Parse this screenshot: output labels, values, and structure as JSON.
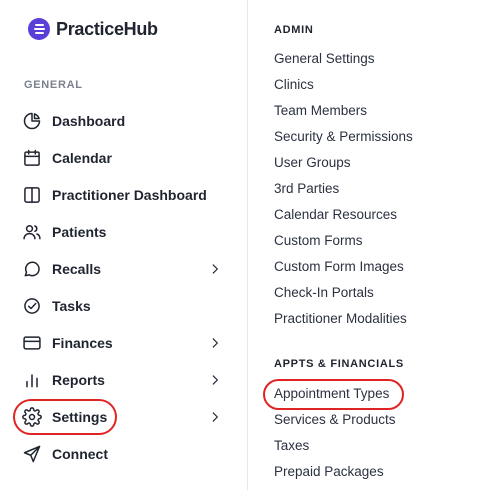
{
  "brand": {
    "name": "PracticeHub",
    "logo_color": "#5a3fd8"
  },
  "sidebar": {
    "section_label": "GENERAL",
    "items": [
      {
        "label": "Dashboard",
        "icon": "pie-chart-icon",
        "has_submenu": false
      },
      {
        "label": "Calendar",
        "icon": "calendar-icon",
        "has_submenu": false
      },
      {
        "label": "Practitioner Dashboard",
        "icon": "split-panel-icon",
        "has_submenu": false
      },
      {
        "label": "Patients",
        "icon": "users-icon",
        "has_submenu": false
      },
      {
        "label": "Recalls",
        "icon": "chat-bubble-icon",
        "has_submenu": true
      },
      {
        "label": "Tasks",
        "icon": "check-circle-icon",
        "has_submenu": false
      },
      {
        "label": "Finances",
        "icon": "credit-card-icon",
        "has_submenu": true
      },
      {
        "label": "Reports",
        "icon": "bar-chart-icon",
        "has_submenu": true
      },
      {
        "label": "Settings",
        "icon": "gear-icon",
        "has_submenu": true,
        "highlighted": true
      },
      {
        "label": "Connect",
        "icon": "send-icon",
        "has_submenu": false
      }
    ]
  },
  "settings_menu": {
    "admin": {
      "heading": "ADMIN",
      "links": [
        "General Settings",
        "Clinics",
        "Team Members",
        "Security & Permissions",
        "User Groups",
        "3rd Parties",
        "Calendar Resources",
        "Custom Forms",
        "Custom Form Images",
        "Check-In Portals",
        "Practitioner Modalities"
      ]
    },
    "appts_financials": {
      "heading": "APPTS & FINANCIALS",
      "links": [
        "Appointment Types",
        "Services & Products",
        "Taxes",
        "Prepaid Packages"
      ],
      "highlighted_link": "Appointment Types"
    }
  },
  "colors": {
    "highlight": "#e02424",
    "text": "#1f2430",
    "muted": "#7b8190"
  }
}
